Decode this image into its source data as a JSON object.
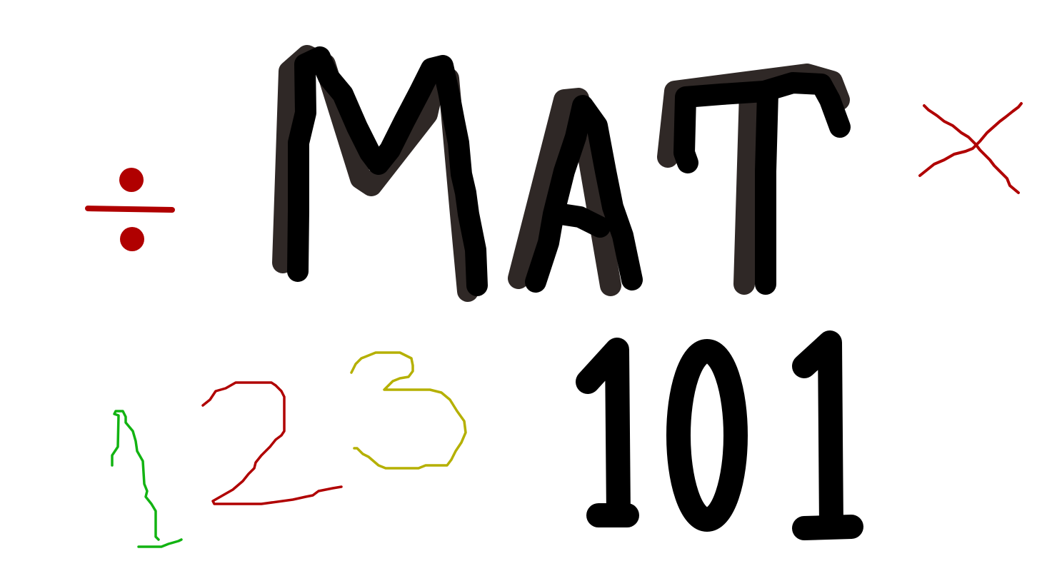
{
  "title": "MAT",
  "course_number": "101",
  "symbols": {
    "divide": "÷",
    "times": "×"
  },
  "doodle_numbers": [
    "1",
    "2",
    "3"
  ],
  "colors": {
    "background": "#ffffff",
    "ink": "#000000",
    "shadow": "#2f2826",
    "red": "#b00000",
    "green": "#12b312",
    "yellow": "#b5b000"
  }
}
